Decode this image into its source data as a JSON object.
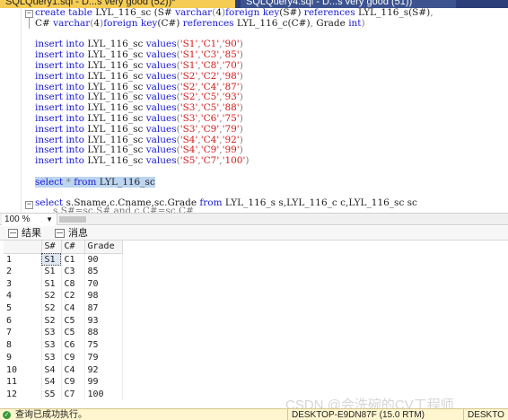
{
  "tabs": [
    {
      "label": "SQLQuery1.sql - D...s very good (52))*"
    },
    {
      "label": "SQLQuery4.sql - D...s very good (51))"
    }
  ],
  "editor": {
    "create_line1": [
      {
        "t": "create",
        "c": "kw"
      },
      {
        "t": " ",
        "c": ""
      },
      {
        "t": "table",
        "c": "kw"
      },
      {
        "t": " LYL_116_sc (S# ",
        "c": ""
      },
      {
        "t": "varchar",
        "c": "kw"
      },
      {
        "t": "(",
        "c": "gray"
      },
      {
        "t": "4",
        "c": ""
      },
      {
        "t": ")",
        "c": "gray"
      },
      {
        "t": "foreign",
        "c": "kw"
      },
      {
        "t": " ",
        "c": ""
      },
      {
        "t": "key",
        "c": "kw"
      },
      {
        "t": "(S#) ",
        "c": ""
      },
      {
        "t": "references",
        "c": "kw"
      },
      {
        "t": " LYL_116_s(S#)",
        "c": ""
      },
      {
        "t": ",",
        "c": "gray"
      }
    ],
    "create_line2": [
      {
        "t": "C# ",
        "c": ""
      },
      {
        "t": "varchar",
        "c": "kw"
      },
      {
        "t": "(",
        "c": "gray"
      },
      {
        "t": "4",
        "c": ""
      },
      {
        "t": ")",
        "c": "gray"
      },
      {
        "t": "foreign",
        "c": "kw"
      },
      {
        "t": " ",
        "c": ""
      },
      {
        "t": "key",
        "c": "kw"
      },
      {
        "t": "(C#) ",
        "c": ""
      },
      {
        "t": "references",
        "c": "kw"
      },
      {
        "t": " LYL_116_c(C#)",
        "c": ""
      },
      {
        "t": ",",
        "c": "gray"
      },
      {
        "t": " Grade ",
        "c": ""
      },
      {
        "t": "int",
        "c": "kw"
      },
      {
        "t": ")",
        "c": "gray"
      }
    ],
    "insert_rows": [
      [
        "S1",
        "C1",
        "90"
      ],
      [
        "S1",
        "C3",
        "85"
      ],
      [
        "S1",
        "C8",
        "70"
      ],
      [
        "S2",
        "C2",
        "98"
      ],
      [
        "S2",
        "C4",
        "87"
      ],
      [
        "S2",
        "C5",
        "93"
      ],
      [
        "S3",
        "C5",
        "88"
      ],
      [
        "S3",
        "C6",
        "75"
      ],
      [
        "S3",
        "C9",
        "79"
      ],
      [
        "S4",
        "C4",
        "92"
      ],
      [
        "S4",
        "C9",
        "99"
      ],
      [
        "S5",
        "C7",
        "100"
      ]
    ],
    "insert_kw": "insert",
    "into_kw": "into",
    "insert_table": "LYL_116_sc",
    "values_kw": "values",
    "select_star": "select * from LYL_116_sc",
    "select_line": "select s.Sname,c.Cname,sc.Grade from LYL_116_s s,LYL_116_c c,LYL_116_sc sc",
    "cut_line": "where s.S#=sc.S# and c.C#=sc.C#"
  },
  "zoom": {
    "value": "100 %"
  },
  "results_tabs": {
    "results": "结果",
    "messages": "消息"
  },
  "grid": {
    "columns": [
      "S#",
      "C#",
      "Grade"
    ],
    "rows": [
      [
        "1",
        "S1",
        "C1",
        "90"
      ],
      [
        "2",
        "S1",
        "C3",
        "85"
      ],
      [
        "3",
        "S1",
        "C8",
        "70"
      ],
      [
        "4",
        "S2",
        "C2",
        "98"
      ],
      [
        "5",
        "S2",
        "C4",
        "87"
      ],
      [
        "6",
        "S2",
        "C5",
        "93"
      ],
      [
        "7",
        "S3",
        "C5",
        "88"
      ],
      [
        "8",
        "S3",
        "C6",
        "75"
      ],
      [
        "9",
        "S3",
        "C9",
        "79"
      ],
      [
        "10",
        "S4",
        "C4",
        "92"
      ],
      [
        "11",
        "S4",
        "C9",
        "99"
      ],
      [
        "12",
        "S5",
        "C7",
        "100"
      ]
    ]
  },
  "status": {
    "message": "查询已成功执行。",
    "server": "DESKTOP-E9DN87F (15.0 RTM)",
    "server2": "DESKTO"
  },
  "watermark": "CSDN @会洗碗的CV工程师"
}
